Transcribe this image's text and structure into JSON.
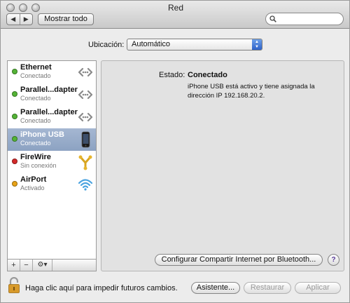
{
  "window": {
    "title": "Red"
  },
  "toolbar": {
    "back_glyph": "◀",
    "forward_glyph": "▶",
    "show_all_label": "Mostrar todo",
    "search_placeholder": ""
  },
  "location": {
    "label": "Ubicación:",
    "value": "Automático"
  },
  "services": [
    {
      "name": "Ethernet",
      "status": "Conectado",
      "status_color": "#54b436",
      "icon": "ethernet-icon",
      "selected": false
    },
    {
      "name": "Parallel...dapter",
      "status": "Conectado",
      "status_color": "#54b436",
      "icon": "ethernet-icon",
      "selected": false
    },
    {
      "name": "Parallel...dapter",
      "status": "Conectado",
      "status_color": "#54b436",
      "icon": "ethernet-icon",
      "selected": false
    },
    {
      "name": "iPhone USB",
      "status": "Conectado",
      "status_color": "#54b436",
      "icon": "iphone-icon",
      "selected": true
    },
    {
      "name": "FireWire",
      "status": "Sin conexión",
      "status_color": "#d42a2a",
      "icon": "firewire-icon",
      "selected": false
    },
    {
      "name": "AirPort",
      "status": "Activado",
      "status_color": "#e8a317",
      "icon": "wifi-icon",
      "selected": false
    }
  ],
  "list_controls": {
    "add": "+",
    "remove": "−",
    "gear": "⚙▾"
  },
  "detail": {
    "state_label": "Estado:",
    "state_value": "Conectado",
    "description": "iPhone USB está activo y tiene asignada la dirección IP 192.168.20.2.",
    "bluetooth_button": "Configurar Compartir Internet por Bluetooth...",
    "help": "?"
  },
  "footer": {
    "lock_text": "Haga clic aquí para impedir futuros cambios.",
    "assistant_button": "Asistente...",
    "restore_button": "Restaurar",
    "apply_button": "Aplicar"
  }
}
